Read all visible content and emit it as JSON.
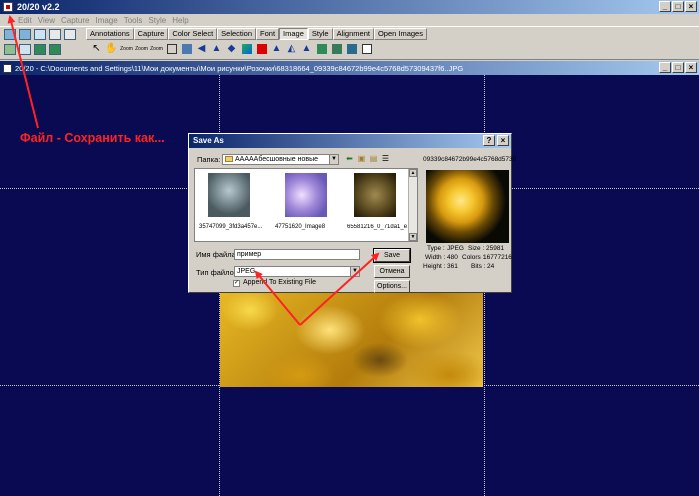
{
  "app": {
    "title": "20/20 v2.2",
    "menu": [
      "Edit",
      "View",
      "Capture",
      "Image",
      "Tools",
      "Style",
      "Help"
    ]
  },
  "toolbar": {
    "tabs": [
      "Annotations",
      "Capture",
      "Color Select",
      "Selection",
      "Font",
      "Image",
      "Style",
      "Alignment",
      "Open Images"
    ],
    "active_tab": "Image",
    "zoom_labels": [
      "Zoom",
      "Zoom",
      "Zoom"
    ]
  },
  "document": {
    "title": "20/20 - C:\\Documents and Settings\\11\\Мои документы\\Мои рисунки\\Розочки\\68318664_09339c84672b99e4c5768d57309437f6..JPG"
  },
  "annotation": {
    "text": "Файл - Сохранить как..."
  },
  "dialog": {
    "title": "Save As",
    "folder_label": "Папка:",
    "folder_value": "АААААбесшовные новые",
    "files": [
      {
        "name": "35747099_3fd3a457e..."
      },
      {
        "name": "47751620_Image8"
      },
      {
        "name": "65581216_0_71da1_e..."
      }
    ],
    "preview_name": "09339c84672b99e4c5768d5730",
    "info": {
      "type_label": "Type :",
      "type_value": "JPEG",
      "size_label": "Size :",
      "size_value": "25981",
      "width_label": "Width :",
      "width_value": "480",
      "colors_label": "Colors :",
      "colors_value": "16777216",
      "height_label": "Height :",
      "height_value": "361",
      "bits_label": "Bits :",
      "bits_value": "24"
    },
    "filename_label": "Имя файла:",
    "filename_value": "пример",
    "filetype_label": "Тип файлов:",
    "filetype_value": "JPEG",
    "append_label": "Append To Existing File",
    "append_checked": true,
    "save_label": "Save",
    "cancel_label": "Отмена",
    "options_label": "Options..."
  },
  "colors": {
    "titlebar": "#0a246a",
    "canvas": "#0a0a52",
    "annotation": "#ff2222"
  }
}
